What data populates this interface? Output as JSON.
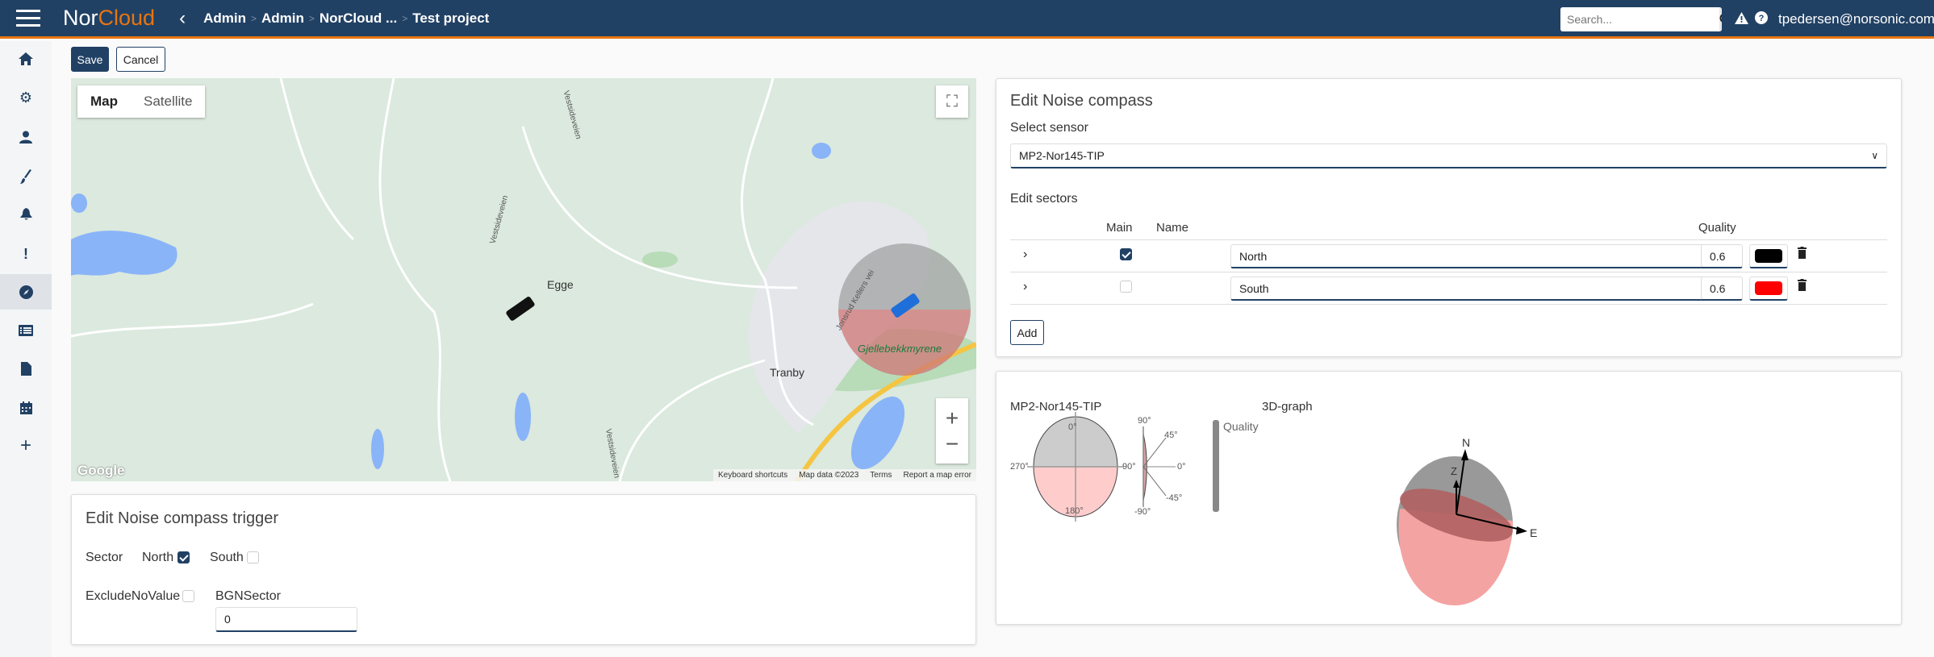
{
  "header": {
    "logo_left": "Nor",
    "logo_right": "Cloud",
    "breadcrumb": [
      "Admin",
      "Admin",
      "NorCloud ...",
      "Test project"
    ],
    "search_placeholder": "Search...",
    "user": "tpedersen@norsonic.com",
    "accent": "#e87511",
    "brand": "#214164"
  },
  "sidebar": {
    "items": [
      {
        "icon": "home-icon"
      },
      {
        "icon": "gear-icon"
      },
      {
        "icon": "user-icon"
      },
      {
        "icon": "brush-icon"
      },
      {
        "icon": "bell-icon"
      },
      {
        "icon": "alert-icon"
      },
      {
        "icon": "compass-icon",
        "active": true
      },
      {
        "icon": "list-icon"
      },
      {
        "icon": "document-icon"
      },
      {
        "icon": "calendar-icon"
      },
      {
        "icon": "plus-icon"
      }
    ]
  },
  "toolbar": {
    "save": "Save",
    "cancel": "Cancel"
  },
  "map": {
    "tabs": [
      "Map",
      "Satellite"
    ],
    "places": [
      "Egge",
      "Tranby",
      "Gjellebekkmyrene"
    ],
    "roads": [
      "Vestsideveien",
      "Vestsideveien",
      "Vestsideveien",
      "Jonsrud Kellers vei"
    ],
    "google": "Google",
    "attribution": [
      "Keyboard shortcuts",
      "Map data ©2023",
      "Terms",
      "Report a map error"
    ],
    "zoom_in": "+",
    "zoom_out": "−"
  },
  "trigger": {
    "title": "Edit Noise compass trigger",
    "sector_label": "Sector",
    "sectors": [
      {
        "name": "North",
        "checked": true
      },
      {
        "name": "South",
        "checked": false
      }
    ],
    "exclude_label": "ExcludeNoValue",
    "exclude_checked": false,
    "bgn_label": "BGNSector",
    "bgn_value": "0"
  },
  "compass": {
    "title": "Edit Noise compass",
    "sensor_label": "Select sensor",
    "sensor_value": "MP2-Nor145-TIP",
    "sectors_label": "Edit sectors",
    "columns": [
      "Main",
      "Name",
      "Quality"
    ],
    "rows": [
      {
        "main": true,
        "name": "North",
        "quality": "0.6",
        "color": "#000000"
      },
      {
        "main": false,
        "name": "South",
        "quality": "0.6",
        "color": "#ff0000"
      }
    ],
    "add": "Add"
  },
  "graph": {
    "sensor": "MP2-Nor145-TIP",
    "title3d": "3D-graph",
    "azimuth_labels": [
      "0°",
      "90°",
      "180°",
      "270°"
    ],
    "elevation_labels": [
      "90°",
      "45°",
      "0°",
      "-45°",
      "-90°"
    ],
    "quality_label": "Quality",
    "axes": [
      "N",
      "Z",
      "E"
    ]
  }
}
